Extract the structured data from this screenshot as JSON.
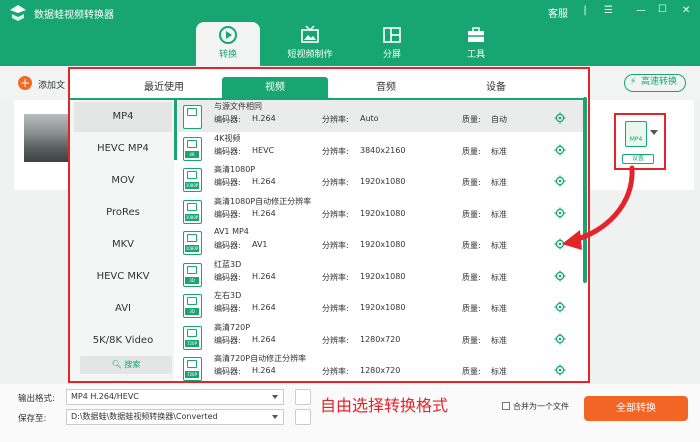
{
  "app": {
    "title": "数据蛙视频转换器",
    "service_label": "客服"
  },
  "main_tabs": [
    {
      "label": "转换",
      "icon": "convert-icon"
    },
    {
      "label": "短视频制作",
      "icon": "tv-icon"
    },
    {
      "label": "分屏",
      "icon": "split-screen-icon"
    },
    {
      "label": "工具",
      "icon": "toolbox-icon"
    }
  ],
  "toolbar": {
    "add_label": "添加文",
    "fast_label": "高速转换"
  },
  "format_panel": {
    "format_label": "MP4",
    "settings_label": "设置"
  },
  "popup": {
    "tabs": [
      "最近使用",
      "视频",
      "音频",
      "设备"
    ],
    "active_tab": 1,
    "formats": [
      "MP4",
      "HEVC MP4",
      "MOV",
      "ProRes",
      "MKV",
      "HEVC MKV",
      "AVI",
      "5K/8K Video"
    ],
    "search_label": "搜索",
    "encoder_label": "编码器:",
    "resolution_label": "分辨率:",
    "quality_label": "质量:",
    "presets": [
      {
        "name": "与源文件相同",
        "tag": "",
        "encoder": "H.264",
        "resolution": "Auto",
        "quality": "自动"
      },
      {
        "name": "4K视频",
        "tag": "4K",
        "encoder": "HEVC",
        "resolution": "3840x2160",
        "quality": "标准"
      },
      {
        "name": "高清1080P",
        "tag": "1080P",
        "encoder": "H.264",
        "resolution": "1920x1080",
        "quality": "标准"
      },
      {
        "name": "高清1080P自动修正分辨率",
        "tag": "1080P",
        "encoder": "H.264",
        "resolution": "1920x1080",
        "quality": "标准"
      },
      {
        "name": "AV1 MP4",
        "tag": "1080P",
        "encoder": "AV1",
        "resolution": "1920x1080",
        "quality": "标准"
      },
      {
        "name": "红蓝3D",
        "tag": "3D",
        "encoder": "H.264",
        "resolution": "1920x1080",
        "quality": "标准"
      },
      {
        "name": "左右3D",
        "tag": "3D",
        "encoder": "H.264",
        "resolution": "1920x1080",
        "quality": "标准"
      },
      {
        "name": "高清720P",
        "tag": "720P",
        "encoder": "H.264",
        "resolution": "1280x720",
        "quality": "标准"
      },
      {
        "name": "高清720P自动修正分辨率",
        "tag": "720P",
        "encoder": "H.264",
        "resolution": "1280x720",
        "quality": "标准"
      }
    ]
  },
  "bottom": {
    "output_format_label": "输出格式:",
    "output_format_value": "MP4 H.264/HEVC",
    "save_to_label": "保存至:",
    "save_to_value": "D:\\数据蛙\\数据蛙视频转换器\\Converted",
    "annotation": "自由选择转换格式",
    "merge_label": "合并为一个文件",
    "convert_all_label": "全部转换"
  },
  "colors": {
    "brand": "#17a672",
    "accent": "#f26524",
    "highlight": "#e3242b"
  }
}
